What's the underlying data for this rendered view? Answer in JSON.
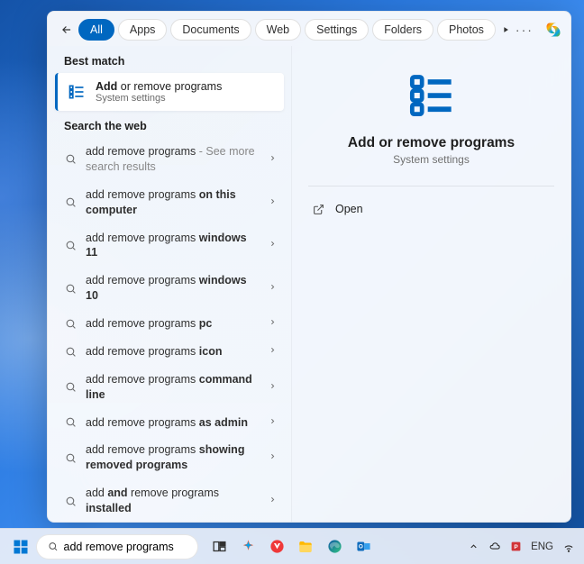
{
  "filters": {
    "back": "←",
    "tabs": [
      "All",
      "Apps",
      "Documents",
      "Web",
      "Settings",
      "Folders",
      "Photos"
    ],
    "active_index": 0
  },
  "sections": {
    "best_match": "Best match",
    "search_web": "Search the web"
  },
  "best_match": {
    "title_prefix": "Add",
    "title_rest": " or remove programs",
    "subtitle": "System settings"
  },
  "web_results": [
    {
      "pre": "add remove programs",
      "bold": "",
      "post": "",
      "dim": " - See more search results"
    },
    {
      "pre": "add remove programs ",
      "bold": "on this computer",
      "post": ""
    },
    {
      "pre": "add remove programs ",
      "bold": "windows 11",
      "post": ""
    },
    {
      "pre": "add remove programs ",
      "bold": "windows 10",
      "post": ""
    },
    {
      "pre": "add remove programs ",
      "bold": "pc",
      "post": ""
    },
    {
      "pre": "add remove programs ",
      "bold": "icon",
      "post": ""
    },
    {
      "pre": "add remove programs ",
      "bold": "command line",
      "post": ""
    },
    {
      "pre": "add remove programs ",
      "bold": "as admin",
      "post": ""
    },
    {
      "pre": "add remove programs ",
      "bold": "showing removed programs",
      "post": ""
    },
    {
      "pre": "add ",
      "bold": "and",
      "post": " remove programs ",
      "bold2": "installed"
    }
  ],
  "preview": {
    "title": "Add or remove programs",
    "subtitle": "System settings",
    "action_open": "Open"
  },
  "taskbar": {
    "search_value": "add remove programs",
    "lang": "ENG"
  }
}
